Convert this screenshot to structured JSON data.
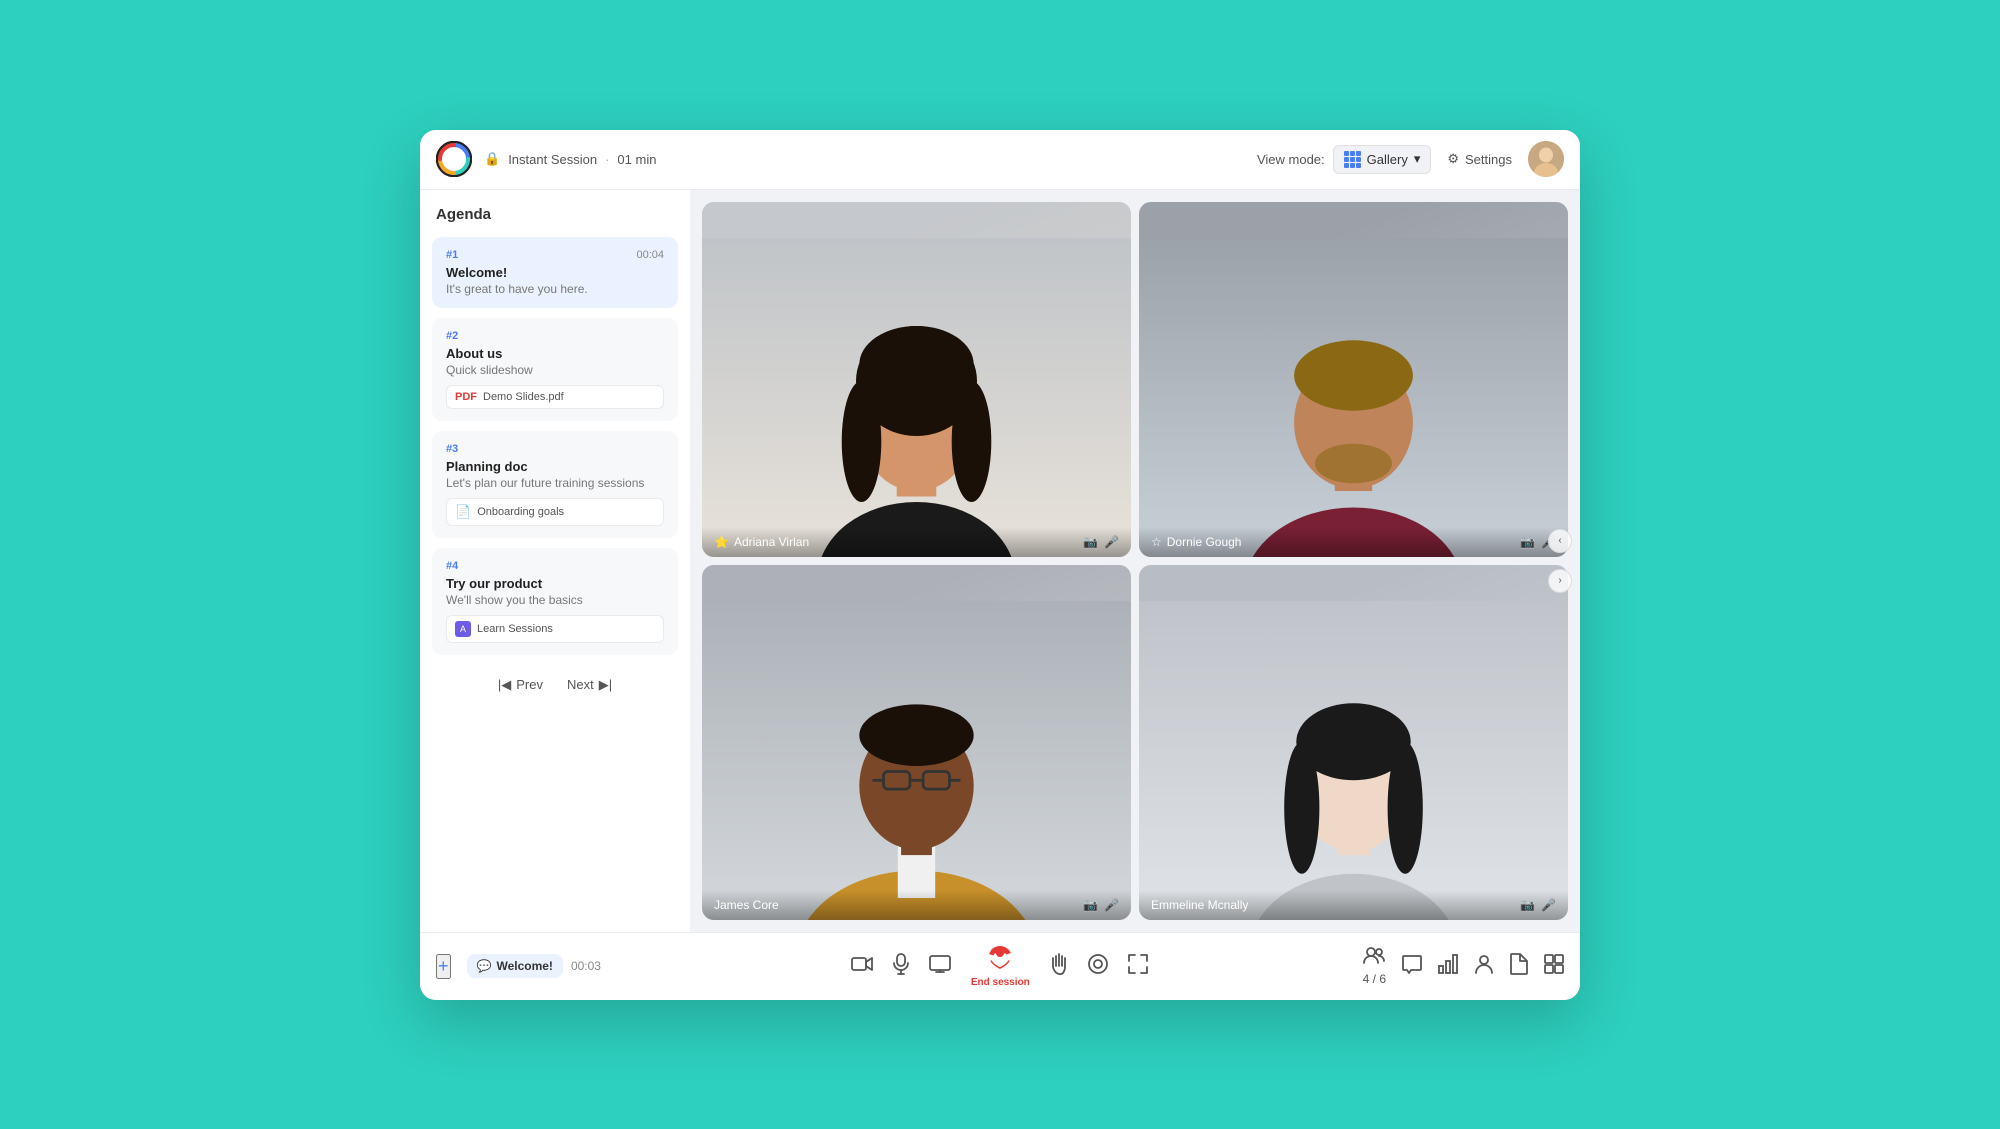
{
  "app": {
    "title": "Instant Session",
    "session_time": "01 min",
    "logo_alt": "App Logo"
  },
  "topbar": {
    "view_mode_label": "View mode:",
    "gallery_label": "Gallery",
    "settings_label": "Settings",
    "dropdown_arrow": "▾"
  },
  "sidebar": {
    "title": "Agenda",
    "items": [
      {
        "num": "#1",
        "title": "Welcome!",
        "desc": "It's great to have you here.",
        "timer": "00:04",
        "active": true,
        "attachment": null
      },
      {
        "num": "#2",
        "title": "About us",
        "desc": "Quick slideshow",
        "timer": null,
        "active": false,
        "attachment": {
          "type": "pdf",
          "name": "Demo Slides.pdf"
        }
      },
      {
        "num": "#3",
        "title": "Planning doc",
        "desc": "Let's plan our future training sessions",
        "timer": null,
        "active": false,
        "attachment": {
          "type": "doc",
          "name": "Onboarding goals"
        }
      },
      {
        "num": "#4",
        "title": "Try our product",
        "desc": "We'll show you the basics",
        "timer": null,
        "active": false,
        "attachment": {
          "type": "learn",
          "name": "Learn Sessions"
        }
      }
    ],
    "nav": {
      "prev_label": "Prev",
      "next_label": "Next"
    }
  },
  "video_grid": {
    "participants": [
      {
        "name": "Adriana Virlan",
        "star": true,
        "color": "#c8a080"
      },
      {
        "name": "Dornie Gough",
        "star": false,
        "color": "#9a7060"
      },
      {
        "name": "James Core",
        "star": false,
        "color": "#6a4830"
      },
      {
        "name": "Emmeline Mcnally",
        "star": false,
        "color": "#b8a090"
      }
    ]
  },
  "bottombar": {
    "plus_icon": "+",
    "session_badge_icon": "💬",
    "session_badge_label": "Welcome!",
    "session_timer": "00:03",
    "controls": [
      {
        "icon": "📹",
        "label": "",
        "id": "video-toggle"
      },
      {
        "icon": "🎤",
        "label": "",
        "id": "mic-toggle"
      },
      {
        "icon": "🖥",
        "label": "",
        "id": "screen-share"
      },
      {
        "icon": "📞",
        "label": "End session",
        "id": "end-session",
        "is_end": true
      },
      {
        "icon": "✋",
        "label": "",
        "id": "raise-hand"
      },
      {
        "icon": "⊙",
        "label": "",
        "id": "record"
      },
      {
        "icon": "⛶",
        "label": "",
        "id": "fullscreen"
      }
    ],
    "right_controls": [
      {
        "icon": "👥",
        "label": "4 / 6",
        "id": "participants"
      },
      {
        "icon": "💬",
        "label": "",
        "id": "chat"
      },
      {
        "icon": "📊",
        "label": "",
        "id": "polls"
      },
      {
        "icon": "👤",
        "label": "",
        "id": "people"
      },
      {
        "icon": "📁",
        "label": "",
        "id": "files"
      },
      {
        "icon": "📋",
        "label": "",
        "id": "more"
      }
    ]
  }
}
